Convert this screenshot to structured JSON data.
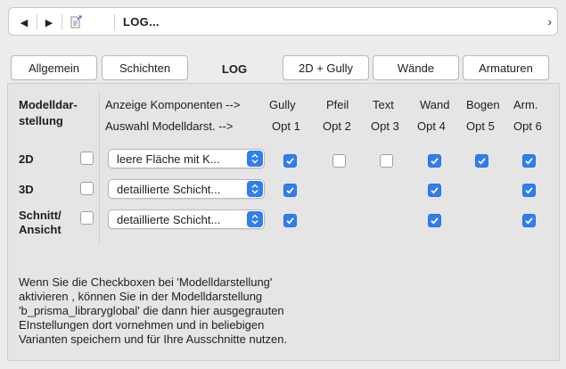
{
  "nav": {
    "title": "LOG..."
  },
  "tabs": [
    {
      "label": "Allgemein"
    },
    {
      "label": "Schichten"
    },
    {
      "label": "LOG",
      "active": true
    },
    {
      "label": "2D + Gully"
    },
    {
      "label": "Wände"
    },
    {
      "label": "Armaturen"
    }
  ],
  "header": {
    "modell_line1": "Modelldar-",
    "modell_line2": "stellung",
    "anzeige": "Anzeige Komponenten -->",
    "auswahl": "Auswahl Modelldarst. -->"
  },
  "columns": [
    {
      "top": "Gully",
      "bottom": "Opt 1"
    },
    {
      "top": "Pfeil",
      "bottom": "Opt 2"
    },
    {
      "top": "Text",
      "bottom": "Opt 3"
    },
    {
      "top": "Wand",
      "bottom": "Opt 4"
    },
    {
      "top": "Bogen",
      "bottom": "Opt 5"
    },
    {
      "top": "Arm.",
      "bottom": "Opt 6"
    }
  ],
  "rows": [
    {
      "label": "2D",
      "modell_checked": false,
      "select": "leere Fläche mit K...",
      "opts": [
        true,
        false,
        false,
        true,
        true,
        true
      ]
    },
    {
      "label": "3D",
      "modell_checked": false,
      "select": "detaillierte Schicht...",
      "opts": [
        true,
        null,
        null,
        true,
        null,
        true
      ]
    },
    {
      "label_line1": "Schnitt/",
      "label_line2": "Ansicht",
      "modell_checked": false,
      "select": "detaillierte Schicht...",
      "opts": [
        true,
        null,
        null,
        true,
        null,
        true
      ]
    }
  ],
  "note": [
    "Wenn Sie die Checkboxen bei 'Modelldarstellung'",
    "aktivieren , können Sie in der Modelldarstellung",
    "'b_prisma_libraryglobal' die dann hier ausgegrauten",
    "EInstellungen dort vornehmen und in beliebigen",
    "Varianten speichern und für Ihre Ausschnitte nutzen."
  ],
  "colors": {
    "accent": "#2f7ef2",
    "panel": "#e5e5e5",
    "window": "#ececec"
  }
}
